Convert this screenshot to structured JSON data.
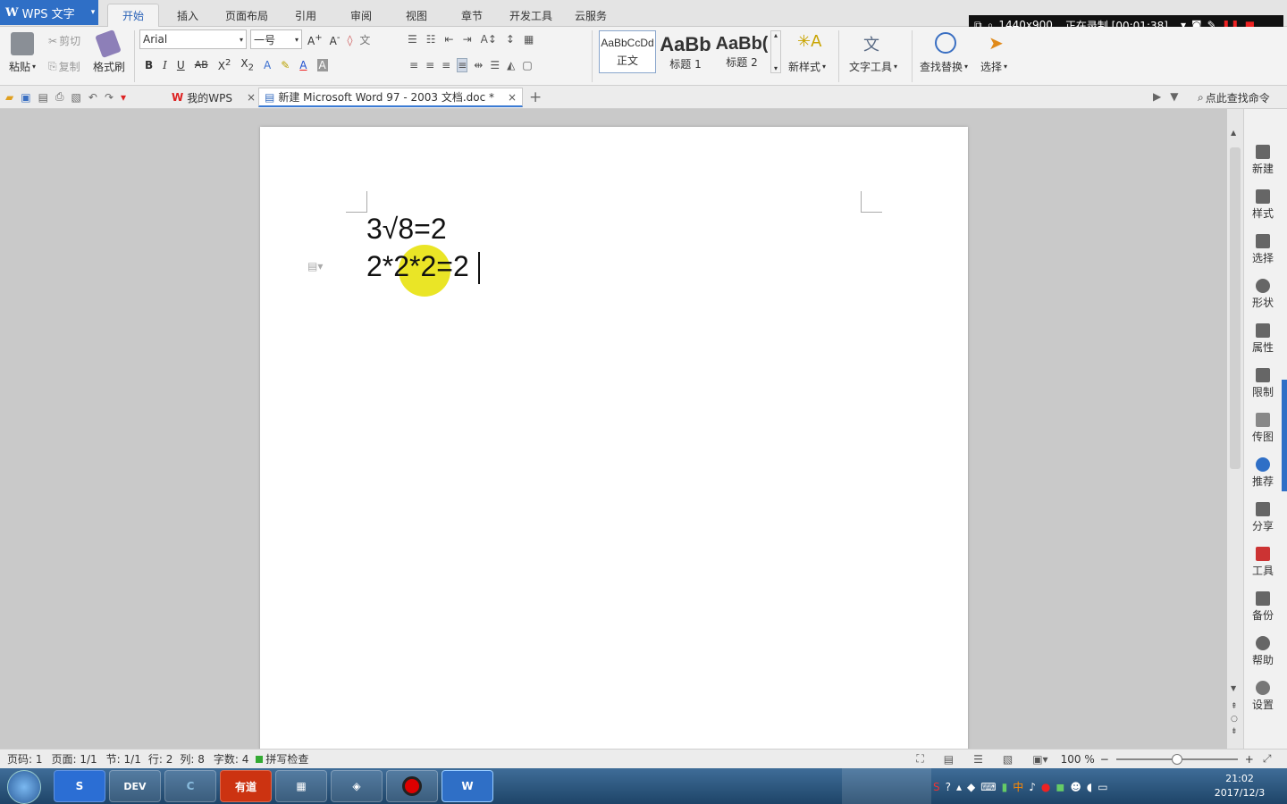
{
  "app": {
    "name": "WPS 文字"
  },
  "menu": {
    "tabs": [
      "开始",
      "插入",
      "页面布局",
      "引用",
      "审阅",
      "视图",
      "章节",
      "开发工具",
      "云服务"
    ],
    "active_tab": "开始"
  },
  "recorder": {
    "resolution": "1440x900",
    "status": "正在录制 [00:01:38]"
  },
  "ribbon": {
    "paste": "粘贴",
    "cut": "剪切",
    "copy": "复制",
    "format_painter": "格式刷",
    "font_name": "Arial",
    "font_size": "一号",
    "styles": [
      {
        "preview": "AaBbCcDd",
        "label": "正文"
      },
      {
        "preview": "AaBb",
        "label": "标题 1"
      },
      {
        "preview": "AaBb(",
        "label": "标题 2"
      }
    ],
    "new_style": "新样式",
    "text_tools": "文字工具",
    "find_replace": "查找替换",
    "select": "选择"
  },
  "tabs_bar": {
    "my_wps": "我的WPS",
    "document_tab": "新建 Microsoft Word 97 - 2003 文档.doc *",
    "search_command": "点此查找命令"
  },
  "document": {
    "line1": "3√8=2",
    "line2": "2*2*2=2"
  },
  "sidebar": {
    "items": [
      "新建",
      "样式",
      "选择",
      "形状",
      "属性",
      "限制",
      "传图",
      "推荐",
      "分享",
      "工具",
      "备份",
      "帮助",
      "设置"
    ]
  },
  "status_bar": {
    "page_code": "页码: 1",
    "pages": "页面: 1/1",
    "section": "节: 1/1",
    "row": "行: 2",
    "col": "列: 8",
    "word_count": "字数: 4",
    "spell_check": "拼写检查",
    "zoom": "100 %"
  },
  "taskbar": {
    "time": "21:02",
    "date": "2017/12/3",
    "apps": [
      "start",
      "sogou",
      "DEV",
      "C",
      "有道",
      "calculator",
      "app",
      "recorder",
      "wps"
    ]
  },
  "colors": {
    "accent": "#2f6fc6",
    "highlight": "#e6e100"
  }
}
